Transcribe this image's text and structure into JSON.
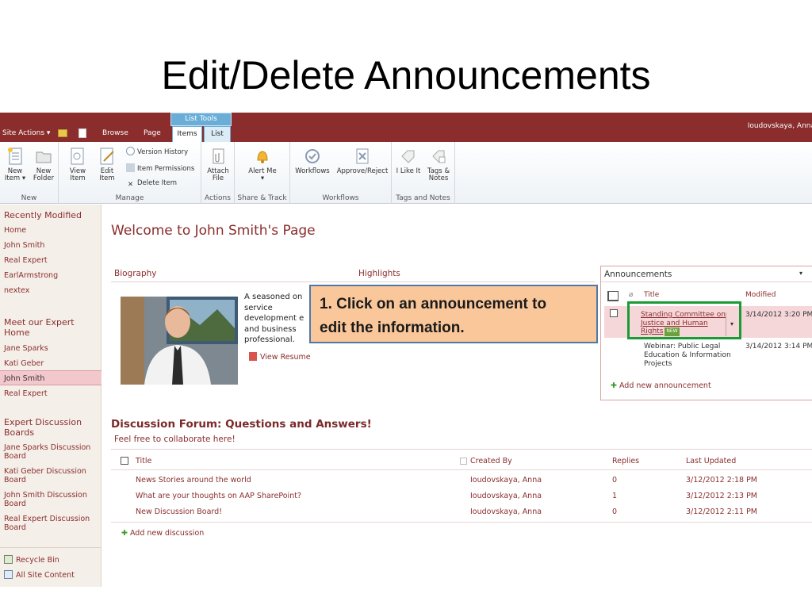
{
  "slide_title": "Edit/Delete Announcements",
  "topbar": {
    "site_actions": "Site Actions ▾",
    "browse": "Browse",
    "page": "Page",
    "list_tools": "List Tools",
    "items_tab": "Items",
    "list_tab": "List",
    "user": "Ioudovskaya, Anna"
  },
  "ribbon": {
    "groups": {
      "new": "New",
      "manage": "Manage",
      "actions": "Actions",
      "share_track": "Share & Track",
      "workflows": "Workflows",
      "tags_notes": "Tags and Notes"
    },
    "new_item": "New Item ▾",
    "new_folder": "New Folder",
    "view_item": "View Item",
    "edit_item": "Edit Item",
    "version_history": "Version History",
    "item_permissions": "Item Permissions",
    "delete_item": "Delete Item",
    "attach_file": "Attach File",
    "alert_me": "Alert Me ▾",
    "workflows": "Workflows",
    "approve_reject": "Approve/Reject",
    "i_like_it": "I Like It",
    "tags_notes": "Tags & Notes"
  },
  "leftnav": {
    "recently_modified": "Recently Modified",
    "recent_items": [
      "Home",
      "John Smith",
      "Real Expert",
      "EarlArmstrong",
      "nextex"
    ],
    "meet_expert_home": "Meet our Expert Home",
    "expert_items": [
      "Jane Sparks",
      "Kati Geber",
      "John Smith",
      "Real Expert"
    ],
    "expert_discussion": "Expert Discussion Boards",
    "boards": [
      "Jane Sparks Discussion Board",
      "Kati Geber Discussion Board",
      "John Smith Discussion Board",
      "Real Expert Discussion Board"
    ],
    "recycle_bin": "Recycle Bin",
    "all_site_content": "All Site Content"
  },
  "content": {
    "welcome": "Welcome to John Smith's Page",
    "biography": "Biography",
    "highlights": "Highlights",
    "bio_lines": [
      "A seasoned on",
      "service",
      "development e",
      "and business",
      "professional."
    ],
    "view_resume": "View Resume"
  },
  "announcements": {
    "title": "Announcements",
    "col_title": "Title",
    "col_modified": "Modified",
    "rows": [
      {
        "title": "Standing Committee on Justice and Human Rights",
        "modified": "3/14/2012 3:20 PM",
        "new_badge": "NEW"
      },
      {
        "title": "Webinar: Public Legal Education & Information Projects",
        "modified": "3/14/2012 3:14 PM"
      }
    ],
    "add_new": "Add new announcement"
  },
  "callout": {
    "text_line1": "1.  Click on an announcement to",
    "text_line2": "edit the information."
  },
  "discussion": {
    "title": "Discussion Forum: Questions and Answers!",
    "subtitle": "Feel free to collaborate here!",
    "headers": {
      "title": "Title",
      "created_by": "Created By",
      "replies": "Replies",
      "last_updated": "Last Updated"
    },
    "rows": [
      {
        "title": "News Stories around the world",
        "created_by": "Ioudovskaya, Anna",
        "replies": "0",
        "last_updated": "3/12/2012 2:18 PM"
      },
      {
        "title": "What are your thoughts on AAP SharePoint?",
        "created_by": "Ioudovskaya, Anna",
        "replies": "1",
        "last_updated": "3/12/2012 2:13 PM"
      },
      {
        "title": "New Discussion Board!",
        "created_by": "Ioudovskaya, Anna",
        "replies": "0",
        "last_updated": "3/12/2012 2:11 PM"
      }
    ],
    "add_new": "Add new discussion"
  }
}
